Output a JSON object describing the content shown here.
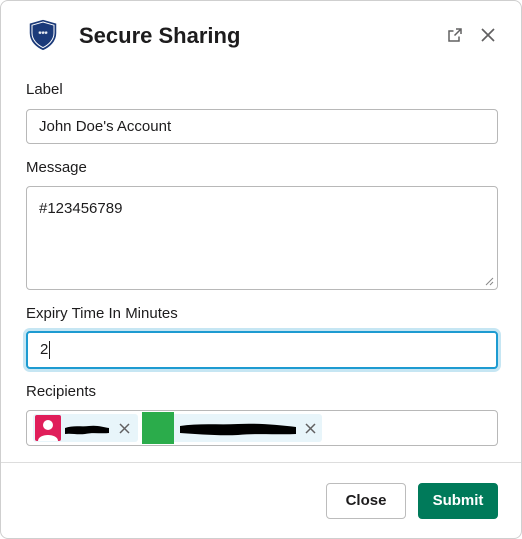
{
  "header": {
    "title": "Secure Sharing",
    "app_icon": "shield-icon",
    "app_icon_text": "***",
    "open_icon": "open-in-new-window-icon",
    "close_icon": "close-icon"
  },
  "form": {
    "label": {
      "label": "Label",
      "value": "John Doe's Account"
    },
    "message": {
      "label": "Message",
      "value": "#123456789"
    },
    "expiry": {
      "label": "Expiry Time In Minutes",
      "value": "2"
    },
    "recipients": {
      "label": "Recipients",
      "chips": [
        {
          "avatar": "person-avatar",
          "name_redacted": true
        },
        {
          "avatar": "green-avatar",
          "name_redacted": true
        }
      ]
    }
  },
  "footer": {
    "close_label": "Close",
    "submit_label": "Submit"
  },
  "colors": {
    "accent_focus": "#1d9bd1",
    "submit_bg": "#007a5a",
    "shield": "#1b3a7a",
    "chip_bg": "#e8f5fa",
    "avatar_pink": "#e01e5a",
    "avatar_green": "#2bac4b"
  }
}
